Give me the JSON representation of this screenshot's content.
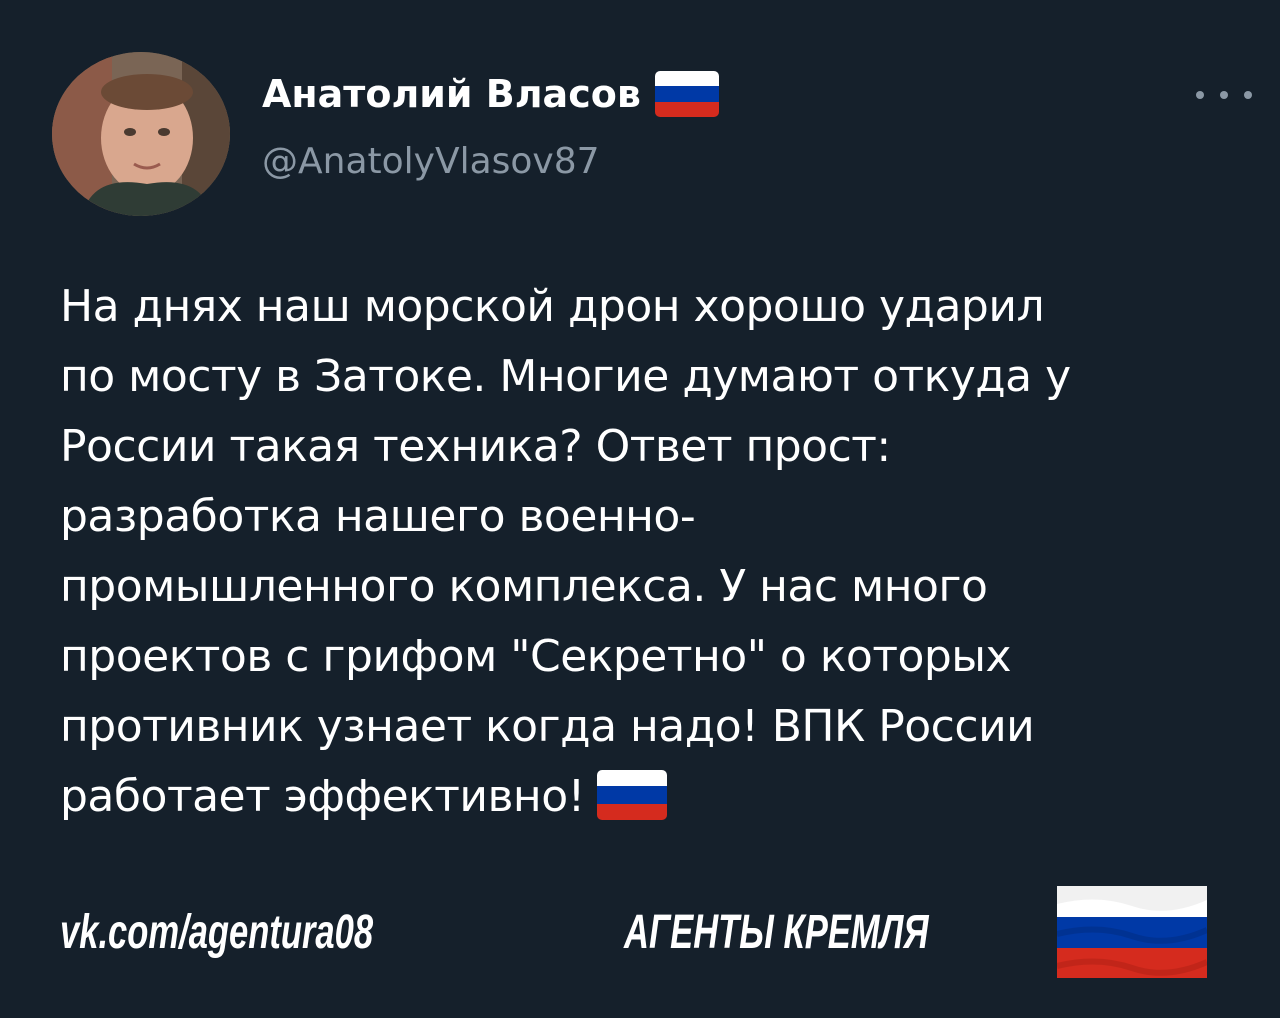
{
  "tweet": {
    "author_name": "Анатолий Власов",
    "author_handle": "@AnatolyVlasov87",
    "text_lines": [
      "На днях наш морской дрон хорошо ударил",
      "по мосту в Затоке. Многие думают откуда у",
      "России такая техника? Ответ прост:",
      "разработка нашего военно-",
      "промышленного комплекса. У нас много",
      "проектов с грифом \"Секретно\" о которых",
      "противник узнает когда надо! ВПК России",
      "работает эффективно!"
    ],
    "icons": {
      "more": "more-icon",
      "flag": "russia-flag-emoji"
    }
  },
  "footer": {
    "link_text": "vk.com/agentura08",
    "title": "АГЕНТЫ КРЕМЛЯ",
    "icon": "russia-flag-icon"
  },
  "colors": {
    "background": "#15202b",
    "text": "#ffffff",
    "secondary_text": "#8b98a5",
    "flag_white": "#ffffff",
    "flag_blue": "#0039a6",
    "flag_red": "#d52b1e"
  }
}
